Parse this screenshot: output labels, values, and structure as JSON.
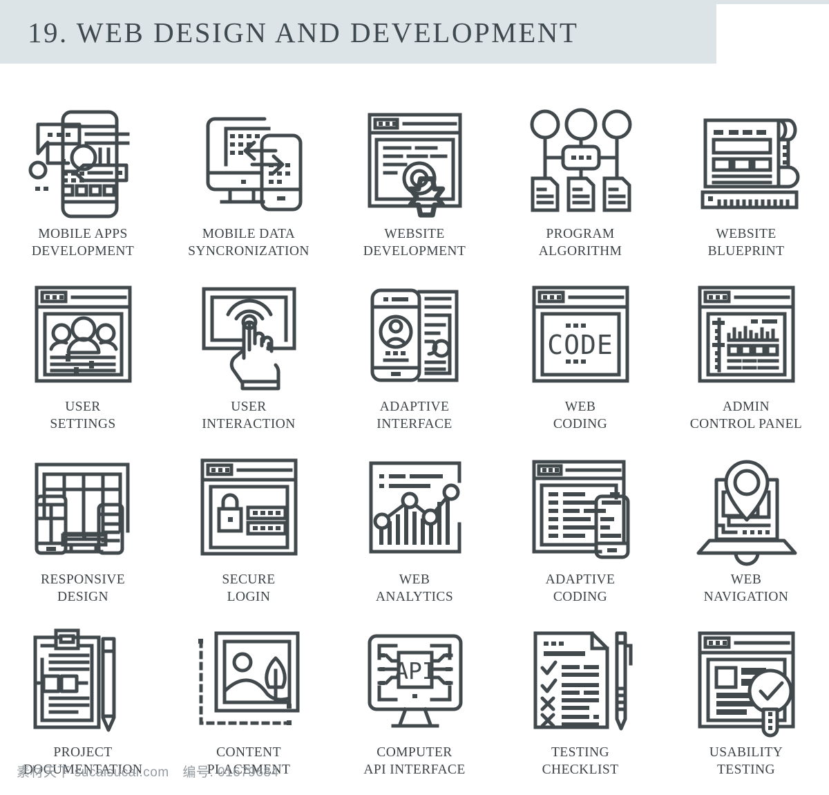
{
  "header": {
    "title": "19. WEB DESIGN AND DEVELOPMENT",
    "band_color": "#dde4e7",
    "title_color": "#3e4a50"
  },
  "theme": {
    "background": "#ffffff",
    "icon_stroke": "#41494d",
    "label_color": "#3c4347"
  },
  "grid": {
    "columns": 5,
    "rows": 4,
    "items": [
      {
        "icon": "mobile-apps-development-icon",
        "label": "MOBILE APPS\nDEVELOPMENT"
      },
      {
        "icon": "mobile-data-syncronization-icon",
        "label": "MOBILE DATA\nSYNCRONIZATION"
      },
      {
        "icon": "website-development-icon",
        "label": "WEBSITE\nDEVELOPMENT"
      },
      {
        "icon": "program-algorithm-icon",
        "label": "PROGRAM\nALGORITHM"
      },
      {
        "icon": "website-blueprint-icon",
        "label": "WEBSITE\nBLUEPRINT"
      },
      {
        "icon": "user-settings-icon",
        "label": "USER\nSETTINGS"
      },
      {
        "icon": "user-interaction-icon",
        "label": "USER\nINTERACTION"
      },
      {
        "icon": "adaptive-interface-icon",
        "label": "ADAPTIVE\nINTERFACE"
      },
      {
        "icon": "web-coding-icon",
        "label": "WEB\nCODING"
      },
      {
        "icon": "admin-control-panel-icon",
        "label": "ADMIN\nCONTROL PANEL"
      },
      {
        "icon": "responsive-design-icon",
        "label": "RESPONSIVE\nDESIGN"
      },
      {
        "icon": "secure-login-icon",
        "label": "SECURE\nLOGIN"
      },
      {
        "icon": "web-analytics-icon",
        "label": "WEB\nANALYTICS"
      },
      {
        "icon": "adaptive-coding-icon",
        "label": "ADAPTIVE\nCODING"
      },
      {
        "icon": "web-navigation-icon",
        "label": "WEB\nNAVIGATION"
      },
      {
        "icon": "project-documentation-icon",
        "label": "PROJECT\nDOCUMENTATION"
      },
      {
        "icon": "content-placement-icon",
        "label": "CONTENT\nPLACEMENT"
      },
      {
        "icon": "computer-api-interface-icon",
        "label": "COMPUTER\nAPI INTERFACE"
      },
      {
        "icon": "testing-checklist-icon",
        "label": "TESTING\nCHECKLIST"
      },
      {
        "icon": "usability-testing-icon",
        "label": "USABILITY\nTESTING"
      }
    ]
  },
  "icon_text": {
    "web_coding": "CODE",
    "computer_api": "API"
  },
  "watermark": {
    "site": "素材天下 sucaisucai.com",
    "id": "编号: 01679684"
  }
}
